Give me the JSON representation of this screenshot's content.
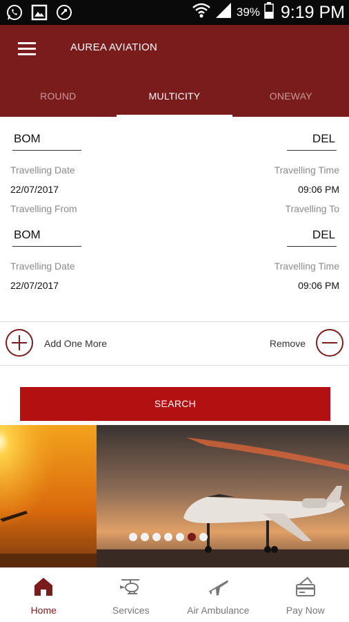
{
  "status_bar": {
    "battery": "39%",
    "time": "9:19 PM",
    "icons": [
      "whatsapp-icon",
      "image-icon",
      "phone-sync-icon",
      "wifi-icon",
      "signal-icon",
      "battery-icon"
    ]
  },
  "app_bar": {
    "title": "AUREA AVIATION",
    "menu_icon": "hamburger-menu-icon"
  },
  "tabs": [
    {
      "label": "ROUND",
      "active": false
    },
    {
      "label": "MULTICITY",
      "active": true
    },
    {
      "label": "ONEWAY",
      "active": false
    }
  ],
  "segments": [
    {
      "from_value": "BOM",
      "to_value": "DEL",
      "date_label": "Travelling Date",
      "date_value": "22/07/2017",
      "time_label": "Travelling Time",
      "time_value": "09:06 PM"
    },
    {
      "from_label": "Travelling From",
      "to_label": "Travelling To",
      "from_value": "BOM",
      "to_value": "DEL",
      "date_label": "Travelling Date",
      "date_value": "22/07/2017",
      "time_label": "Travelling Time",
      "time_value": "09:06 PM"
    }
  ],
  "actions": {
    "add_label": "Add One More",
    "remove_label": "Remove"
  },
  "search_label": "SEARCH",
  "banner": {
    "slide_count": 7,
    "active_slide": 6
  },
  "bottom_nav": [
    {
      "label": "Home",
      "icon": "home-icon",
      "active": true
    },
    {
      "label": "Services",
      "icon": "helicopter-icon",
      "active": false
    },
    {
      "label": "Air Ambulance",
      "icon": "airplane-icon",
      "active": false
    },
    {
      "label": "Pay Now",
      "icon": "card-payment-icon",
      "active": false
    }
  ],
  "colors": {
    "primary": "#7a1c1c",
    "button": "#b31111",
    "muted_label": "#8a8a8a"
  }
}
